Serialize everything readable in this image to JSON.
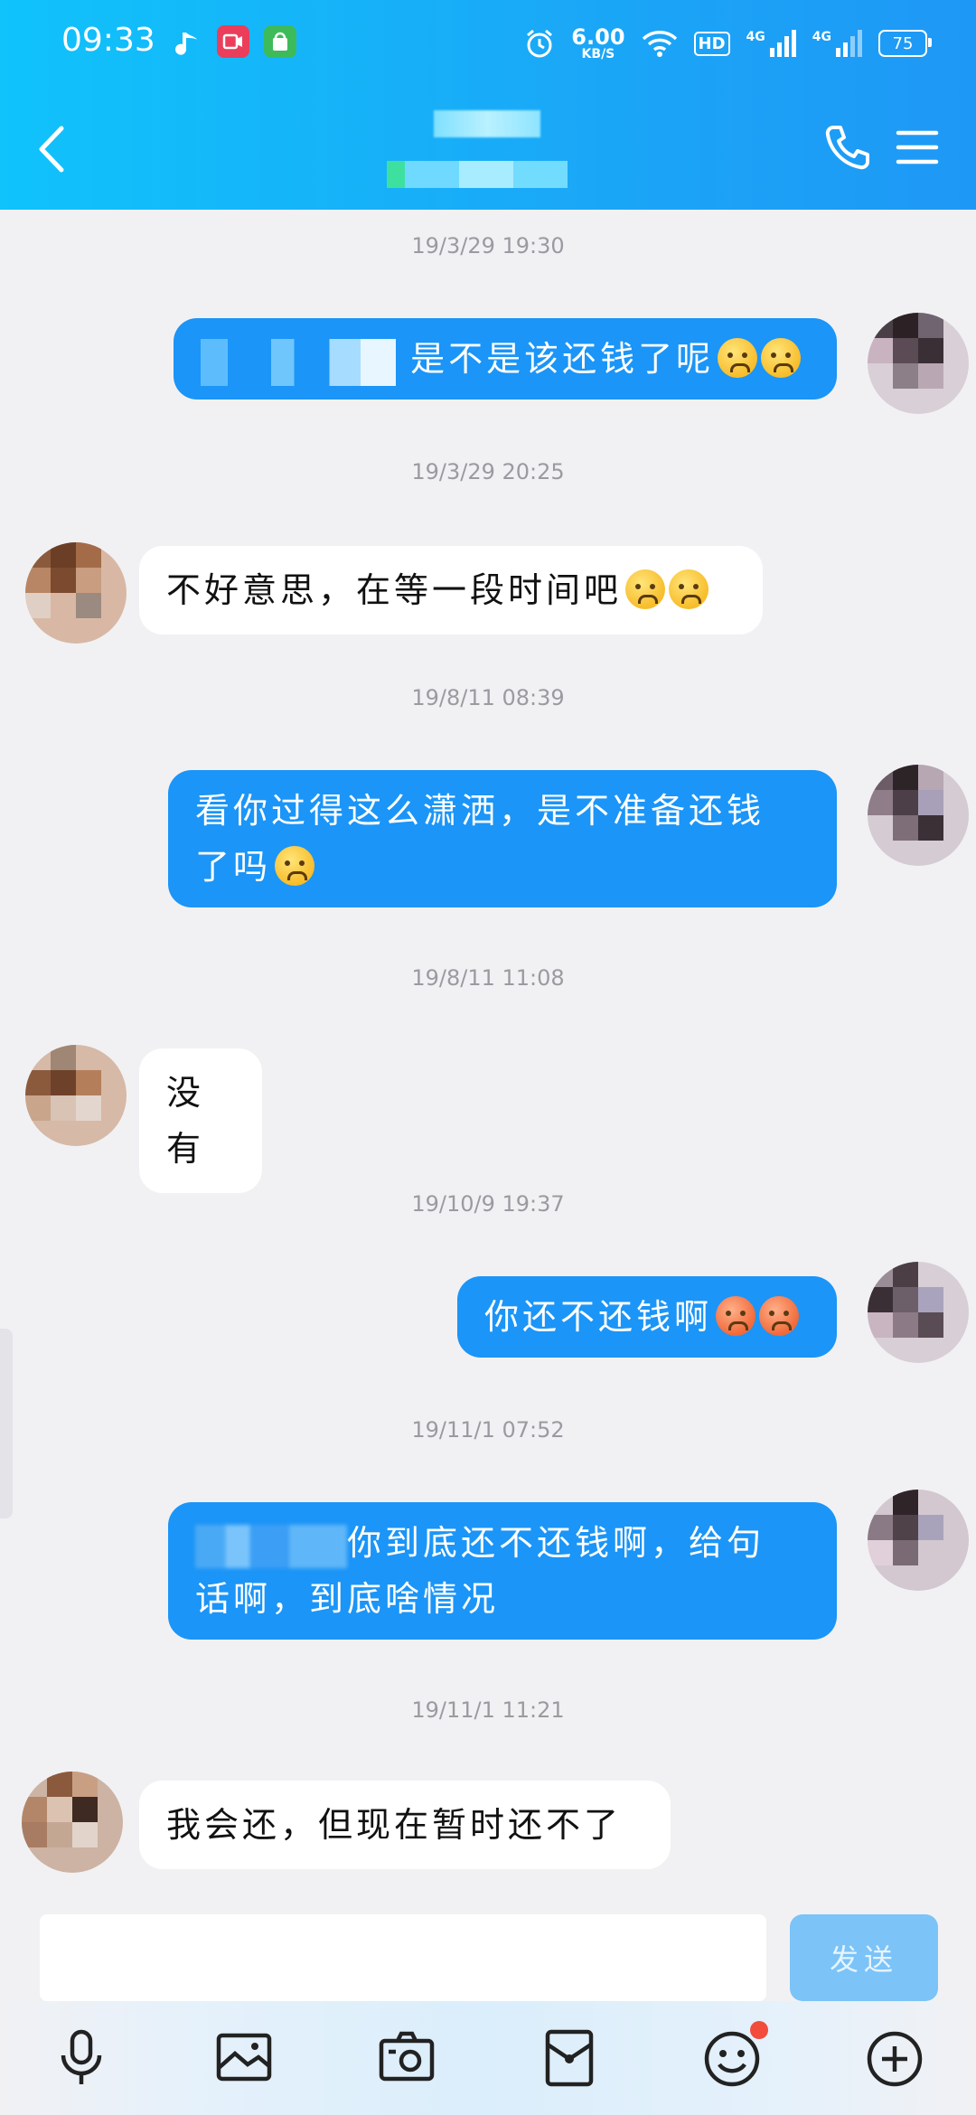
{
  "status_bar": {
    "time": "09:33",
    "net_speed_value": "6.00",
    "net_speed_unit": "KB/S",
    "hd_label": "HD",
    "signal_1_label": "4G",
    "signal_2_label": "4G",
    "battery": "75"
  },
  "header": {
    "back_icon": "back-chevron-icon",
    "call_icon": "phone-icon",
    "menu_icon": "menu-icon",
    "accent_color": "#12b4fa"
  },
  "chat": {
    "timestamps": [
      "19/3/29 19:30",
      "19/3/29 20:25",
      "19/8/11 08:39",
      "19/8/11 11:08",
      "19/10/9 19:37",
      "19/11/1 07:52",
      "19/11/1 11:21"
    ],
    "messages": [
      {
        "direction": "out",
        "text": "是不是该还钱了呢"
      },
      {
        "direction": "in",
        "text": "不好意思，在等一段时间吧"
      },
      {
        "direction": "out",
        "line1": "看你过得这么潇洒，是不准备还钱",
        "line2": "了吗"
      },
      {
        "direction": "in",
        "text": "没有"
      },
      {
        "direction": "out",
        "text": "你还不还钱啊"
      },
      {
        "direction": "out",
        "line1": "你到底还不还钱啊，给句",
        "line2": "话啊，到底啥情况"
      },
      {
        "direction": "in",
        "text": "我会还，但现在暂时还不了"
      }
    ],
    "outgoing_color": "#1b95f7",
    "incoming_color": "#ffffff"
  },
  "input": {
    "value": "",
    "send_label": "发送"
  },
  "toolbar": {
    "icons": [
      "microphone-icon",
      "image-icon",
      "camera-icon",
      "red-packet-icon",
      "emoji-icon",
      "plus-icon"
    ],
    "notification_color": "#f24c3c"
  }
}
